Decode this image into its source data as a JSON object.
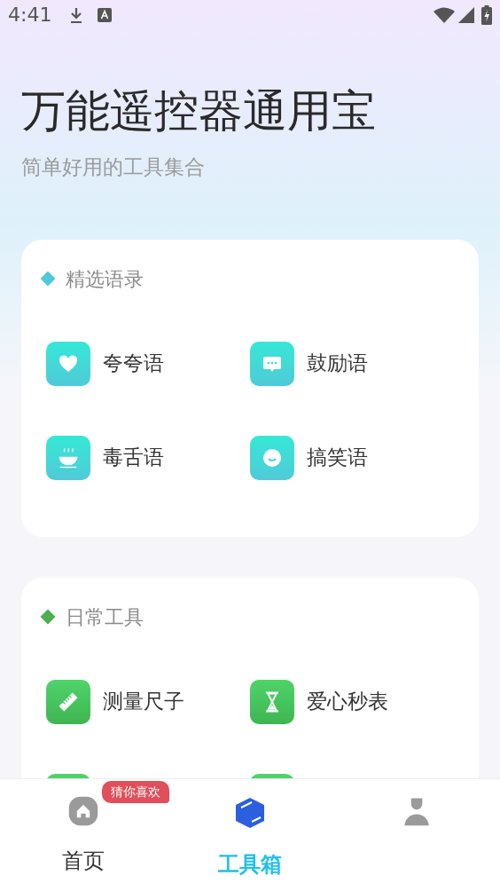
{
  "status_bar": {
    "time": "4:41"
  },
  "header": {
    "title": "万能遥控器通用宝",
    "subtitle": "简单好用的工具集合"
  },
  "sections": [
    {
      "title": "精选语录",
      "color": "#4fc8da",
      "items": [
        {
          "kind": "tool",
          "label": "夸夸语"
        },
        {
          "kind": "tool",
          "label": "鼓励语"
        },
        {
          "kind": "tool",
          "label": "毒舌语"
        },
        {
          "kind": "tool",
          "label": "搞笑语"
        }
      ]
    },
    {
      "title": "日常工具",
      "color": "#4caf50",
      "items": [
        {
          "kind": "tool",
          "label": "测量尺子"
        },
        {
          "kind": "tool",
          "label": "爱心秒表"
        },
        {
          "kind": "tile"
        },
        {
          "kind": "tile"
        }
      ]
    }
  ],
  "tabs": [
    {
      "label": "首页",
      "selected": false,
      "badge": "猜你喜欢"
    },
    {
      "label": "工具箱",
      "selected": true
    },
    {
      "selected": false
    }
  ]
}
